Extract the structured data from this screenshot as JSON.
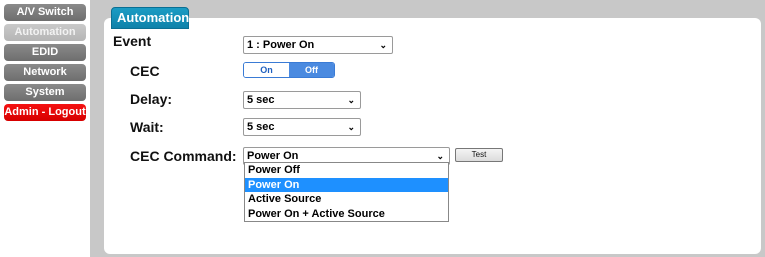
{
  "sidebar": {
    "items": [
      {
        "label": "A/V Switch"
      },
      {
        "label": "Automation"
      },
      {
        "label": "EDID"
      },
      {
        "label": "Network"
      },
      {
        "label": "System"
      },
      {
        "label": "Admin - Logout"
      }
    ]
  },
  "tab": {
    "label": "Automation"
  },
  "form": {
    "event": {
      "label": "Event",
      "value": "1 : Power On"
    },
    "cec": {
      "label": "CEC",
      "on_label": "On",
      "off_label": "Off",
      "selected": "Off"
    },
    "delay": {
      "label": "Delay:",
      "value": "5 sec"
    },
    "wait": {
      "label": "Wait:",
      "value": "5 sec"
    },
    "cec_command": {
      "label": "CEC Command:",
      "value": "Power On",
      "test_label": "Test",
      "options": [
        "Power Off",
        "Power On",
        "Active Source",
        "Power On + Active Source"
      ],
      "highlighted": "Power On"
    }
  },
  "colors": {
    "tab": "#1597c0",
    "logout": "#e60000",
    "toggle_active": "#4a8ae0",
    "highlight": "#1e90ff"
  }
}
